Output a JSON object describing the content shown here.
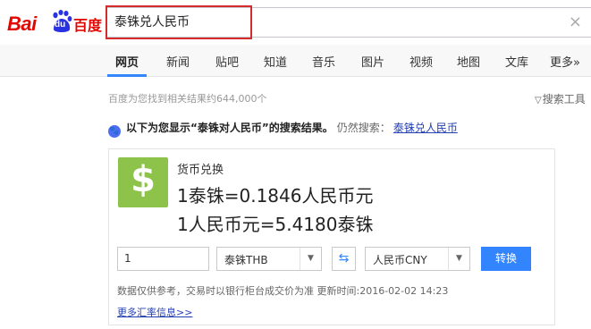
{
  "logo": {
    "bai": "Bai",
    "du": "du",
    "cn": "百度"
  },
  "search": {
    "value": "泰铢兑人民币",
    "clear": "×"
  },
  "nav": {
    "tabs": [
      "网页",
      "新闻",
      "贴吧",
      "知道",
      "音乐",
      "图片",
      "视频",
      "地图",
      "文库",
      "更多»"
    ]
  },
  "results": {
    "count": "百度为您找到相关结果约644,000个",
    "tools": "搜索工具"
  },
  "notice": {
    "prefix": "以下为您显示“",
    "query": "泰铢对人民币",
    "suffix": "”的搜索结果。",
    "alt_label": "仍然搜索：",
    "alt_link": "泰铢兑人民币"
  },
  "card": {
    "title": "货币兑换",
    "rate1": "1泰铢=0.1846人民币元",
    "rate2": "1人民币元=5.4180泰铢",
    "amount": "1",
    "from_currency": "泰铢THB",
    "to_currency": "人民币CNY",
    "convert_label": "转换",
    "disclaimer": "数据仅供参考，交易时以银行柜台成交价为准 更新时间:2016-02-02 14:23",
    "more_link": "更多汇率信息>>"
  },
  "colors": {
    "brand_red": "#e10601",
    "link": "#2440b3",
    "button": "#3385ff",
    "icon_green": "#8dc34a"
  }
}
